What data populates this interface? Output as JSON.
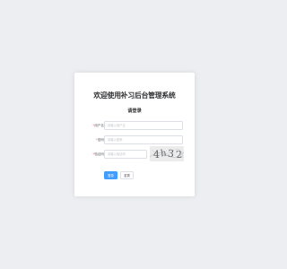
{
  "login": {
    "title": "欢迎使用补习后台管理系统",
    "subtitle": "请登录",
    "fields": {
      "username": {
        "label": "用户名",
        "placeholder": "请输入用户名"
      },
      "password": {
        "label": "密码",
        "placeholder": "请输入密码"
      },
      "captcha": {
        "label": "验证码",
        "placeholder": "请输入验证码"
      }
    },
    "required_mark": "*",
    "captcha_image_text": "4h32",
    "buttons": {
      "submit": "登录",
      "reset": "重置"
    }
  },
  "colors": {
    "background": "#eceef1",
    "card": "#ffffff",
    "primary": "#409eff",
    "required": "#f56c6c",
    "text": "#303133"
  }
}
